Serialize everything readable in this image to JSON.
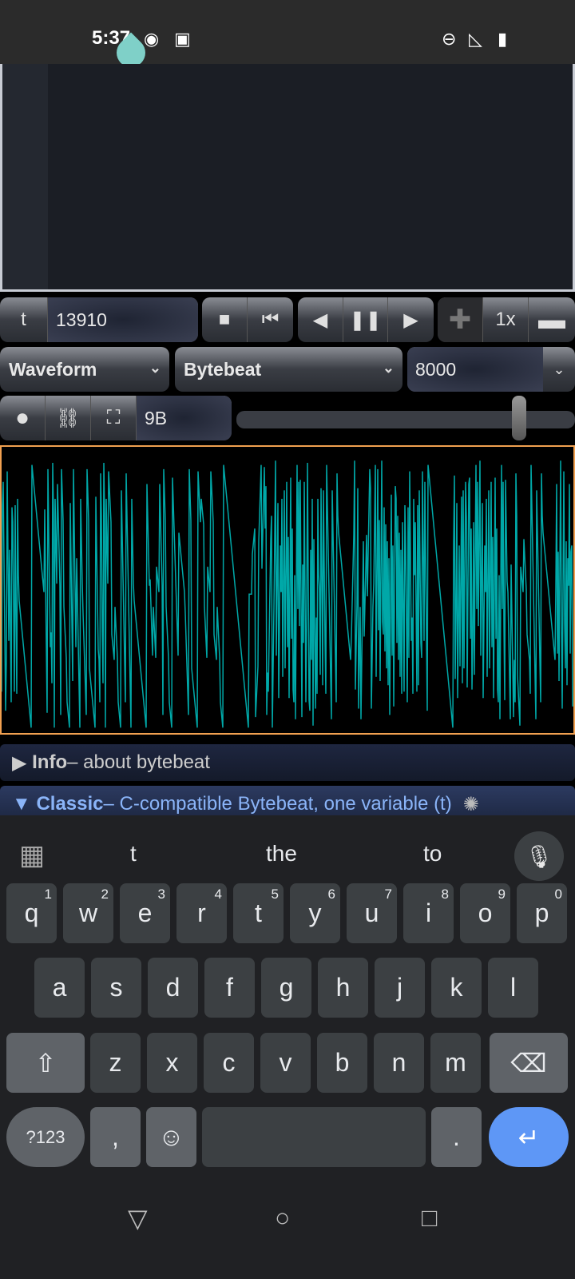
{
  "status": {
    "time": "5:37"
  },
  "transport": {
    "t_label": "t",
    "t_value": "13910",
    "speed": "1x"
  },
  "selects": {
    "mode": "Waveform",
    "type": "Bytebeat",
    "rate": "8000"
  },
  "tools": {
    "size": "9B",
    "volume": 0.8
  },
  "colors": {
    "wave": "#00a8a8",
    "border": "#f0a050",
    "accent": "#8ab4f8"
  },
  "panels": {
    "info": {
      "arrow": "▶",
      "title": "Info",
      "desc": " – about bytebeat"
    },
    "classic": {
      "arrow": "▼",
      "title": "Classic",
      "desc": " – C-compatible Bytebeat, one variable (t)"
    }
  },
  "keyboard": {
    "suggestions": [
      "t",
      "the",
      "to"
    ],
    "row1": [
      [
        "q",
        "1"
      ],
      [
        "w",
        "2"
      ],
      [
        "e",
        "3"
      ],
      [
        "r",
        "4"
      ],
      [
        "t",
        "5"
      ],
      [
        "y",
        "6"
      ],
      [
        "u",
        "7"
      ],
      [
        "i",
        "8"
      ],
      [
        "o",
        "9"
      ],
      [
        "p",
        "0"
      ]
    ],
    "row2": [
      "a",
      "s",
      "d",
      "f",
      "g",
      "h",
      "j",
      "k",
      "l"
    ],
    "row3": [
      "z",
      "x",
      "c",
      "v",
      "b",
      "n",
      "m"
    ],
    "sym": "?123",
    "comma": ",",
    "period": "."
  }
}
